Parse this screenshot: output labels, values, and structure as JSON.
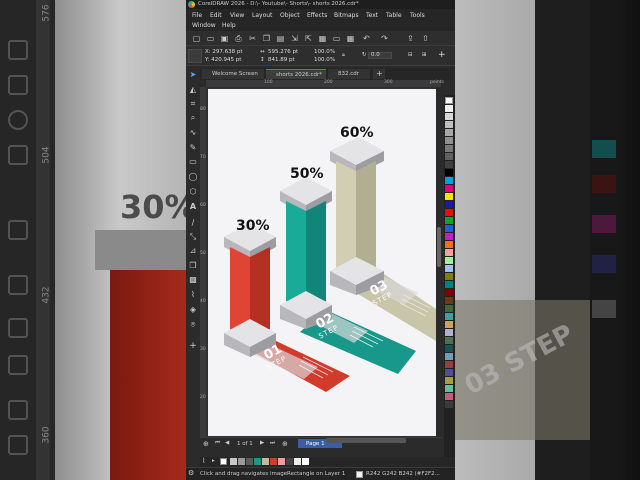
{
  "background": {
    "big_text": "30%",
    "step_text": "03 STEP",
    "ruler_labels": [
      "576",
      "504",
      "432",
      "360"
    ]
  },
  "app": {
    "title": "CorelDRAW 2026 - D:\\- Youtube\\- Shorts\\- shorts 2026.cdr*",
    "menu": {
      "row1": [
        "File",
        "Edit",
        "View",
        "Layout",
        "Object",
        "Effects",
        "Bitmaps",
        "Text",
        "Table",
        "Tools"
      ],
      "row2": [
        "Window",
        "Help"
      ]
    },
    "property_bar": {
      "x": "X: 297.638 pt",
      "y": "Y: 420.945 pt",
      "width": "595.276 pt",
      "height": "841.89 pt",
      "scale_x": "100.0",
      "scale_y": "100.0",
      "pct_x": "%",
      "pct_y": "%",
      "rotation": "0.0"
    },
    "tabs": [
      "Welcome Screen",
      "shorts 2026.cdr*",
      "832.cdr"
    ],
    "ruler_h_labels": [
      "100",
      "200",
      "300"
    ],
    "ruler_h_units": "points",
    "ruler_v_labels": [
      "800",
      "700",
      "600",
      "500",
      "400",
      "300",
      "200"
    ],
    "page_nav": {
      "counter": "1 of 1",
      "page_tab": "Page 1"
    },
    "status": {
      "hint": "Click and drag navigates image",
      "object": "Rectangle on Layer 1",
      "color": "R242 G242 B242 (#F2F2..."
    },
    "colors": {
      "accent": "#3a7bd5",
      "red": "#d23a2c",
      "teal": "#17988a",
      "khaki": "#bfbb9c"
    }
  },
  "infographic": {
    "bars": [
      {
        "percent": "30%",
        "step_number": "01",
        "step_word": "STEP",
        "color": "#d23a2c"
      },
      {
        "percent": "50%",
        "step_number": "02",
        "step_word": "STEP",
        "color": "#17988a"
      },
      {
        "percent": "60%",
        "step_number": "03",
        "step_word": "STEP",
        "color": "#bfbb9c"
      }
    ]
  }
}
